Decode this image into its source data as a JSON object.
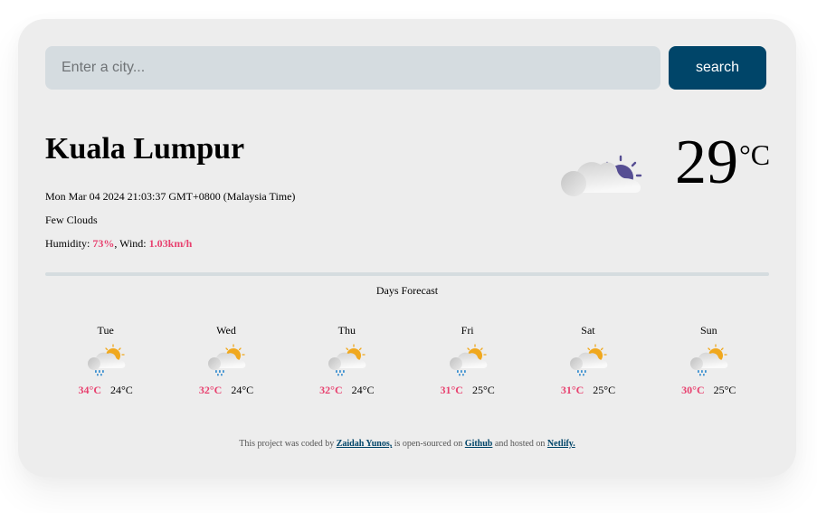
{
  "search": {
    "placeholder": "Enter a city...",
    "value": "",
    "button_label": "search"
  },
  "current": {
    "city": "Kuala Lumpur",
    "date": "Mon Mar 04 2024 21:03:37 GMT+0800 (Malaysia Time)",
    "description": "Few Clouds",
    "humidity_label": "Humidity: ",
    "humidity_value": "73%",
    "wind_label": ", Wind: ",
    "wind_value": "1.03km/h",
    "temperature": "29",
    "unit": "°C",
    "icon": "few-clouds-night-icon"
  },
  "forecast": {
    "title": "Days Forecast",
    "days": [
      {
        "day": "Tue",
        "max": "34°C",
        "min": "24°C",
        "icon": "rain-sun-icon"
      },
      {
        "day": "Wed",
        "max": "32°C",
        "min": "24°C",
        "icon": "rain-sun-icon"
      },
      {
        "day": "Thu",
        "max": "32°C",
        "min": "24°C",
        "icon": "rain-sun-icon"
      },
      {
        "day": "Fri",
        "max": "31°C",
        "min": "25°C",
        "icon": "rain-sun-icon"
      },
      {
        "day": "Sat",
        "max": "31°C",
        "min": "25°C",
        "icon": "rain-sun-icon"
      },
      {
        "day": "Sun",
        "max": "30°C",
        "min": "25°C",
        "icon": "rain-sun-icon"
      }
    ]
  },
  "footer": {
    "text1": "This project was coded by ",
    "author": "Zaidah Yunos,",
    "text2": " is open-sourced on ",
    "github": "Github",
    "text3": " and hosted on ",
    "netlify": "Netlify."
  },
  "colors": {
    "accent": "#e8416f",
    "button": "#004569",
    "input_bg": "#d5dce0",
    "card_bg": "#ededed",
    "sun_day": "#f0a81e",
    "sun_night": "#564e93",
    "rain": "#3a8fd0"
  }
}
